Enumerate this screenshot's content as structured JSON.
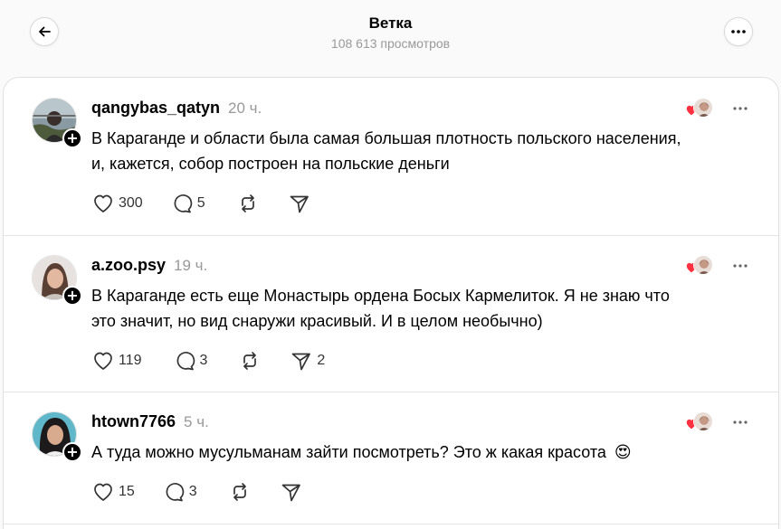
{
  "header": {
    "title": "Ветка",
    "views": "108 613 просмотров"
  },
  "icons": {
    "back": "arrow-left-icon",
    "more": "more-horizontal-icon",
    "like": "heart-icon",
    "reply": "comment-bubble-icon",
    "repost": "repost-icon",
    "share": "send-icon",
    "follow": "plus-icon",
    "liked_by": "heart-badge-icon"
  },
  "colors": {
    "accent_heart": "#ff3040",
    "muted_text": "#999999"
  },
  "posts": [
    {
      "username": "qangybas_qatyn",
      "time": "20 ч.",
      "text_line1": "В Караганде и области была самая большая плотность польского населения,",
      "text_line2": "и, кажется, собор построен на польские деньги",
      "likes": "300",
      "replies": "5",
      "reposts": "",
      "shares": ""
    },
    {
      "username": "a.zoo.psy",
      "time": "19 ч.",
      "text_line1": "В Караганде есть еще Монастырь ордена Босых Кармелиток. Я не знаю что",
      "text_line2": "это значит, но вид снаружи красивый. И в целом необычно)",
      "likes": "119",
      "replies": "3",
      "reposts": "",
      "shares": "2"
    },
    {
      "username": "htown7766",
      "time": "5 ч.",
      "text_line1": "А туда можно мусульманам зайти посмотреть? Это ж какая красота",
      "emoji": "😍",
      "likes": "15",
      "replies": "3",
      "reposts": "",
      "shares": ""
    }
  ]
}
